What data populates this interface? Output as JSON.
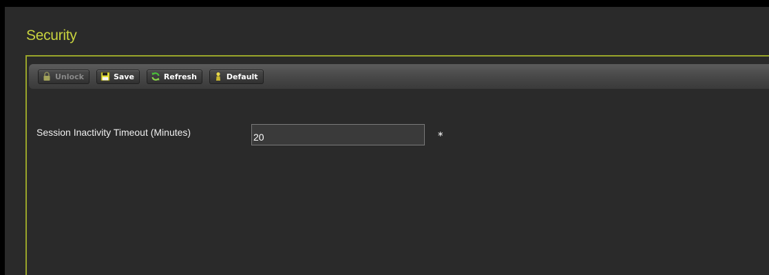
{
  "page": {
    "title": "Security"
  },
  "toolbar": {
    "unlock_label": "Unlock",
    "save_label": "Save",
    "refresh_label": "Refresh",
    "default_label": "Default"
  },
  "form": {
    "timeout_label": "Session Inactivity Timeout (Minutes)",
    "timeout_value": "20",
    "required_mark": "*"
  },
  "colors": {
    "accent": "#c8d33e",
    "panel_border": "#9aa62a",
    "background": "#2a2a2a"
  }
}
